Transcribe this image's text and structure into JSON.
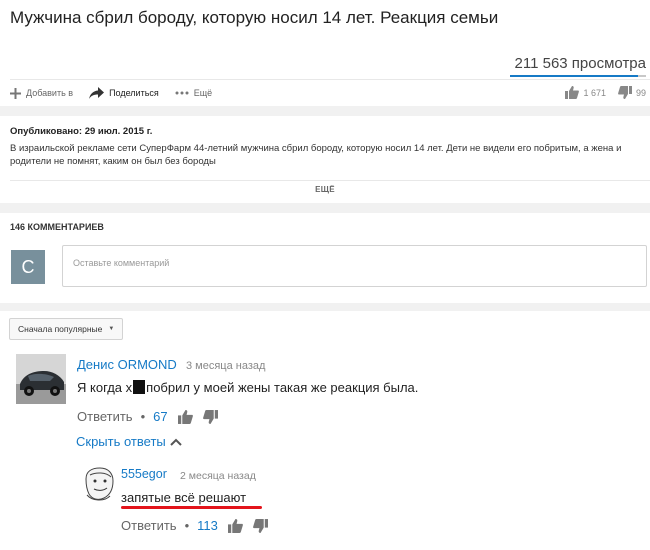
{
  "video": {
    "title": "Мужчина сбрил бороду, которую носил 14 лет. Реакция семьи",
    "views": "211 563 просмотра",
    "like_ratio": 0.94
  },
  "actions": {
    "add_label": "Добавить в",
    "share_label": "Поделиться",
    "more_label": "Ещё",
    "likes": "1 671",
    "dislikes": "99"
  },
  "description": {
    "published": "Опубликовано: 29 июл. 2015 г.",
    "text": "В израильской рекламе сети СуперФарм 44-летний мужчина сбрил бороду, которую носил 14 лет. Дети не видели его побритым, а жена и родители не помнят, каким он был без бороды",
    "more_label": "ЕЩЁ"
  },
  "comments": {
    "count_label": "146 КОММЕНТАРИЕВ",
    "user_initial": "C",
    "placeholder": "Оставьте комментарий",
    "sort_label": "Сначала популярные",
    "hide_replies_label": "Скрыть ответы",
    "items": [
      {
        "author": "Денис ORMOND",
        "time": "3 месяца назад",
        "text_before": "Я когда х",
        "text_after": "побрил у моей жены такая же реакция была.",
        "reply_label": "Ответить",
        "likes": "67"
      }
    ],
    "replies": [
      {
        "author": "555egor",
        "time": "2 месяца назад",
        "text": "запятые всё решают",
        "reply_label": "Ответить",
        "likes": "113"
      }
    ]
  },
  "colors": {
    "link_blue": "#167ac6",
    "highlight_red": "#e3141b",
    "avatar_bg": "#78909c"
  }
}
